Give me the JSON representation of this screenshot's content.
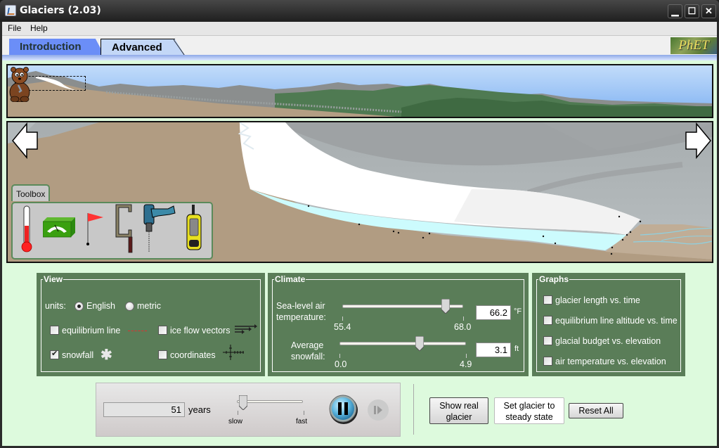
{
  "window": {
    "title": "Glaciers (2.03)",
    "controls": [
      "minimize",
      "maximize",
      "close"
    ]
  },
  "menu": [
    {
      "label": "File"
    },
    {
      "label": "Help"
    }
  ],
  "tabs": [
    {
      "label": "Introduction",
      "selected": false
    },
    {
      "label": "Advanced",
      "selected": true
    }
  ],
  "logo": "PhET",
  "toolbox": {
    "label": "Toolbox",
    "tools": [
      "thermometer-icon",
      "glacial-budget-meter-icon",
      "ice-flow-marker-flag-icon",
      "tracer-flag-icon",
      "ice-core-drill-icon",
      "gps-receiver-icon"
    ]
  },
  "view_panel": {
    "title": "View",
    "units_label": "units:",
    "units_options": [
      {
        "label": "English",
        "selected": true
      },
      {
        "label": "metric",
        "selected": false
      }
    ],
    "checks": [
      {
        "label": "equilibrium line",
        "checked": false
      },
      {
        "label": "ice flow vectors",
        "checked": false
      },
      {
        "label": "snowfall",
        "checked": true
      },
      {
        "label": "coordinates",
        "checked": false
      }
    ]
  },
  "climate_panel": {
    "title": "Climate",
    "temperature": {
      "label_line1": "Sea-level air",
      "label_line2": "temperature:",
      "min": "55.4",
      "max": "68.0",
      "value": "66.2",
      "value_num": 66.2,
      "min_num": 55.4,
      "max_num": 68.0,
      "unit": "°F"
    },
    "snowfall": {
      "label_line1": "Average",
      "label_line2": "snowfall:",
      "min": "0.0",
      "max": "4.9",
      "value": "3.1",
      "value_num": 3.1,
      "min_num": 0.0,
      "max_num": 4.9,
      "unit": "ft"
    }
  },
  "graphs_panel": {
    "title": "Graphs",
    "checks": [
      {
        "label": "glacier length vs. time",
        "checked": false
      },
      {
        "label": "equilibrium line altitude vs. time",
        "checked": false
      },
      {
        "label": "glacial budget vs. elevation",
        "checked": false
      },
      {
        "label": "air temperature vs. elevation",
        "checked": false
      }
    ]
  },
  "clock": {
    "elapsed": "51",
    "elapsed_unit": "years",
    "speed_min_label": "slow",
    "speed_max_label": "fast",
    "speed_fraction": 0.1,
    "playing": true
  },
  "buttons": {
    "show_real_glacier": "Show real glacier",
    "steady_state": "Set glacier to steady state",
    "reset_all": "Reset All"
  }
}
